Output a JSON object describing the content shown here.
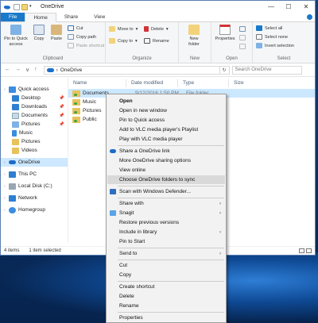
{
  "window": {
    "title": "OneDrive",
    "controls": {
      "minimize": "—",
      "maximize": "☐",
      "close": "✕"
    }
  },
  "tabs": [
    {
      "label": "File"
    },
    {
      "label": "Home"
    },
    {
      "label": "Share"
    },
    {
      "label": "View"
    }
  ],
  "ribbon": {
    "clipboard": {
      "label": "Clipboard",
      "pin_to_quick_access": "Pin to Quick access",
      "copy": "Copy",
      "paste": "Paste",
      "cut": "Cut",
      "copy_path": "Copy path",
      "paste_shortcut": "Paste shortcut"
    },
    "organize": {
      "label": "Organize",
      "move_to": "Move to",
      "copy_to": "Copy to",
      "delete": "Delete",
      "rename": "Rename"
    },
    "new": {
      "label": "New",
      "new_folder": "New folder"
    },
    "open": {
      "label": "Open",
      "properties": "Properties"
    },
    "select": {
      "label": "Select",
      "select_all": "Select all",
      "select_none": "Select none",
      "invert_selection": "Invert selection"
    }
  },
  "address": {
    "back": "←",
    "forward": "→",
    "recent": "∨",
    "up": "↑",
    "path": "OneDrive",
    "separator": "›",
    "refresh": "↻",
    "search_placeholder": "Search OneDrive"
  },
  "navpane": {
    "items": [
      {
        "label": "Quick access",
        "pinned": false
      },
      {
        "label": "Desktop",
        "pinned": true
      },
      {
        "label": "Downloads",
        "pinned": true
      },
      {
        "label": "Documents",
        "pinned": true
      },
      {
        "label": "Pictures",
        "pinned": true
      },
      {
        "label": "Music",
        "pinned": false
      },
      {
        "label": "Pictures",
        "pinned": false
      },
      {
        "label": "Videos",
        "pinned": false
      },
      {
        "label": "OneDrive",
        "pinned": false
      },
      {
        "label": "This PC",
        "pinned": false
      },
      {
        "label": "Local Disk (C:)",
        "pinned": false
      },
      {
        "label": "Network",
        "pinned": false
      },
      {
        "label": "Homegroup",
        "pinned": false
      }
    ],
    "pin_glyph": "📌"
  },
  "columns": {
    "name": "Name",
    "date_modified": "Date modified",
    "type": "Type",
    "size": "Size"
  },
  "files": [
    {
      "name": "Documents",
      "date": "9/12/2016 1:50 PM",
      "type": "File folder"
    },
    {
      "name": "Music"
    },
    {
      "name": "Pictures"
    },
    {
      "name": "Public"
    }
  ],
  "status": {
    "item_count": "4 items",
    "selected": "1 item selected"
  },
  "context_menu": {
    "items": [
      "Open",
      "Open in new window",
      "Pin to Quick access",
      "Add to VLC media player's Playlist",
      "Play with VLC media player",
      "Share a OneDrive link",
      "More OneDrive sharing options",
      "View online",
      "Choose OneDrive folders to sync",
      "Scan with Windows Defender...",
      "Share with",
      "Snagit",
      "Restore previous versions",
      "Include in library",
      "Pin to Start",
      "Send to",
      "Cut",
      "Copy",
      "Create shortcut",
      "Delete",
      "Rename",
      "Properties"
    ],
    "submenu_arrow": "›",
    "highlighted_item": "Choose OneDrive folders to sync"
  },
  "colors": {
    "accent": "#1979ca",
    "selection": "#cce8ff",
    "folder": "#e8c25a",
    "onedrive": "#1c6dc9"
  }
}
